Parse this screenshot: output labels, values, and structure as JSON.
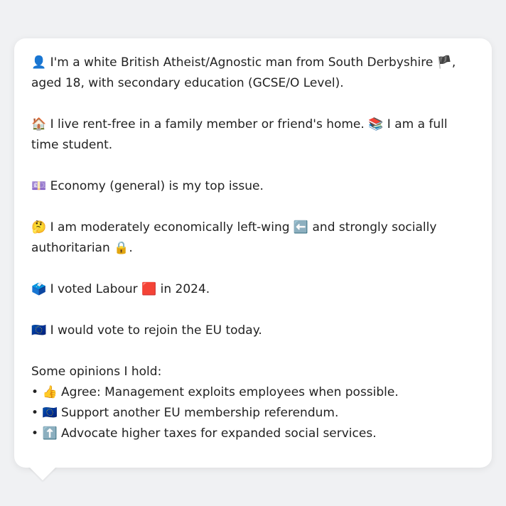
{
  "profile": {
    "identity": {
      "icon": "👤",
      "text_before_flag": " I'm a white British Atheist/Agnostic man from South Derbyshire ",
      "flag": "🏴",
      "text_after_flag": ", aged 18, with secondary education (GCSE/O Level)."
    },
    "living": {
      "icon_home": "🏠",
      "text_home": " I live rent-free in a family member or friend's home. ",
      "icon_books": "📚",
      "text_student": " I am a full time student."
    },
    "top_issue": {
      "icon": "💷",
      "text": " Economy (general) is my top issue."
    },
    "ideology": {
      "icon_think": "🤔",
      "text_econ": " I am moderately economically left-wing ",
      "icon_left": "⬅️",
      "text_social": " and strongly socially authoritarian ",
      "icon_lock": "🔒",
      "text_end": "."
    },
    "vote": {
      "icon_ballot": "🗳️",
      "text_voted": " I voted Labour ",
      "icon_party": "🟥",
      "text_year": " in 2024."
    },
    "eu": {
      "icon": "🇪🇺",
      "text": " I would vote to rejoin the EU today."
    },
    "opinions_heading": "Some opinions I hold:",
    "opinions": [
      {
        "bullet": "•",
        "icon": "👍",
        "text": " Agree: Management exploits employees when possible."
      },
      {
        "bullet": "•",
        "icon": "🇪🇺",
        "text": " Support another EU membership referendum."
      },
      {
        "bullet": "•",
        "icon": "⬆️",
        "text": " Advocate higher taxes for expanded social services."
      }
    ]
  }
}
